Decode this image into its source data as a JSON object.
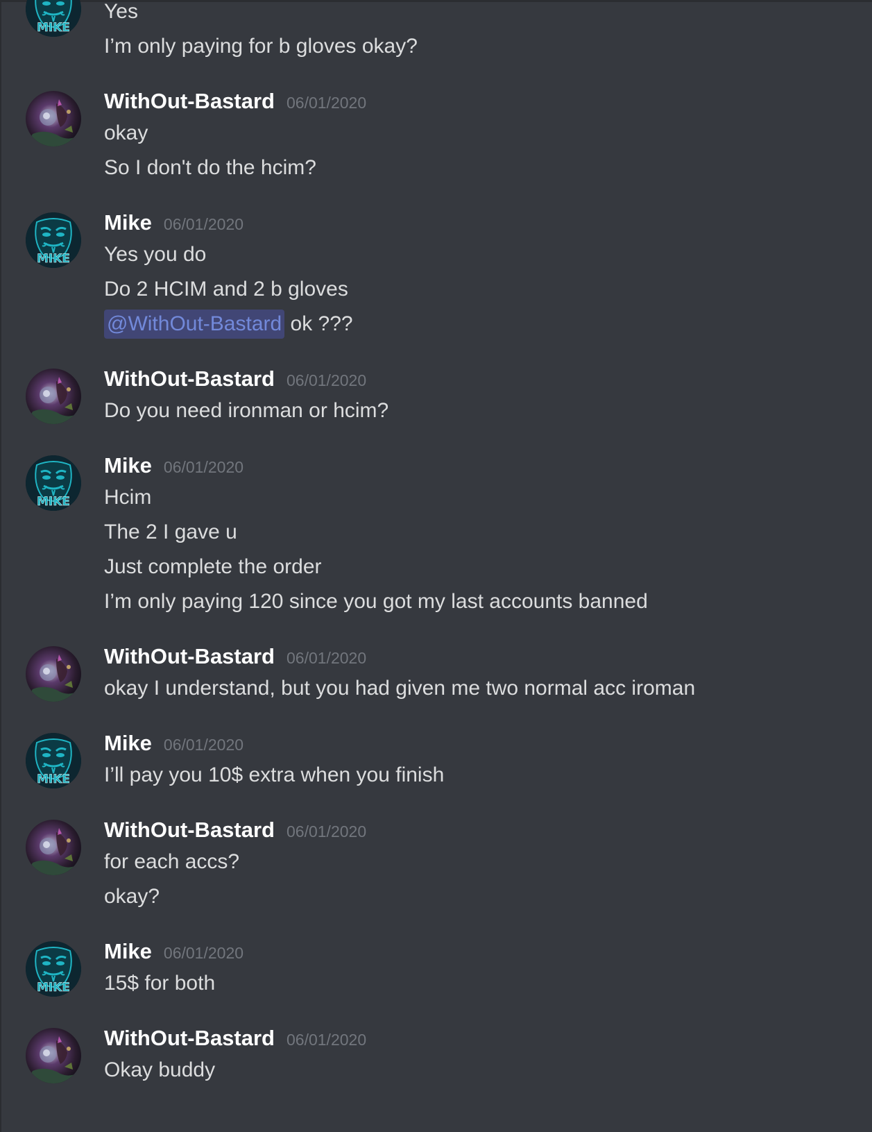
{
  "messages": [
    {
      "author": "",
      "avatar": "mike",
      "timestamp": "",
      "continuation": true,
      "lines": [
        {
          "text": "Yes"
        },
        {
          "text": "I’m only paying for b gloves okay?"
        }
      ]
    },
    {
      "author": "WithOut-Bastard",
      "avatar": "withoutbastard",
      "timestamp": "06/01/2020",
      "lines": [
        {
          "text": "okay"
        },
        {
          "text": "So I don't do the hcim?"
        }
      ]
    },
    {
      "author": "Mike",
      "avatar": "mike",
      "timestamp": "06/01/2020",
      "lines": [
        {
          "text": "Yes you do"
        },
        {
          "text": "Do 2 HCIM and 2 b gloves"
        },
        {
          "mention": "@WithOut-Bastard",
          "text": " ok ???"
        }
      ]
    },
    {
      "author": "WithOut-Bastard",
      "avatar": "withoutbastard",
      "timestamp": "06/01/2020",
      "lines": [
        {
          "text": "Do you need ironman or hcim?"
        }
      ]
    },
    {
      "author": "Mike",
      "avatar": "mike",
      "timestamp": "06/01/2020",
      "lines": [
        {
          "text": "Hcim"
        },
        {
          "text": "The 2 I gave u"
        },
        {
          "text": "Just complete the order"
        },
        {
          "text": "I’m only paying 120 since you got my last accounts banned"
        }
      ]
    },
    {
      "author": "WithOut-Bastard",
      "avatar": "withoutbastard",
      "timestamp": "06/01/2020",
      "lines": [
        {
          "text": "okay I understand, but you had given me two normal acc iroman"
        }
      ]
    },
    {
      "author": "Mike",
      "avatar": "mike",
      "timestamp": "06/01/2020",
      "lines": [
        {
          "text": "I’ll pay you 10$ extra when you finish"
        }
      ]
    },
    {
      "author": "WithOut-Bastard",
      "avatar": "withoutbastard",
      "timestamp": "06/01/2020",
      "lines": [
        {
          "text": "for each accs?"
        },
        {
          "text": "okay?"
        }
      ]
    },
    {
      "author": "Mike",
      "avatar": "mike",
      "timestamp": "06/01/2020",
      "lines": [
        {
          "text": "15$ for both"
        }
      ]
    },
    {
      "author": "WithOut-Bastard",
      "avatar": "withoutbastard",
      "timestamp": "06/01/2020",
      "lines": [
        {
          "text": "Okay buddy"
        }
      ]
    }
  ],
  "avatars": {
    "mike": {
      "label": "MIKE",
      "icon": "guy-fawkes-mask-icon",
      "color": "#1fb5c4"
    },
    "withoutbastard": {
      "icon": "fantasy-character-icon",
      "color": "#5b3a6b"
    }
  },
  "colors": {
    "background": "#36393f",
    "username": "#ffffff",
    "timestamp": "#72767d",
    "text": "#dcddde",
    "mention_bg": "#414675",
    "mention_text": "#7289da"
  }
}
